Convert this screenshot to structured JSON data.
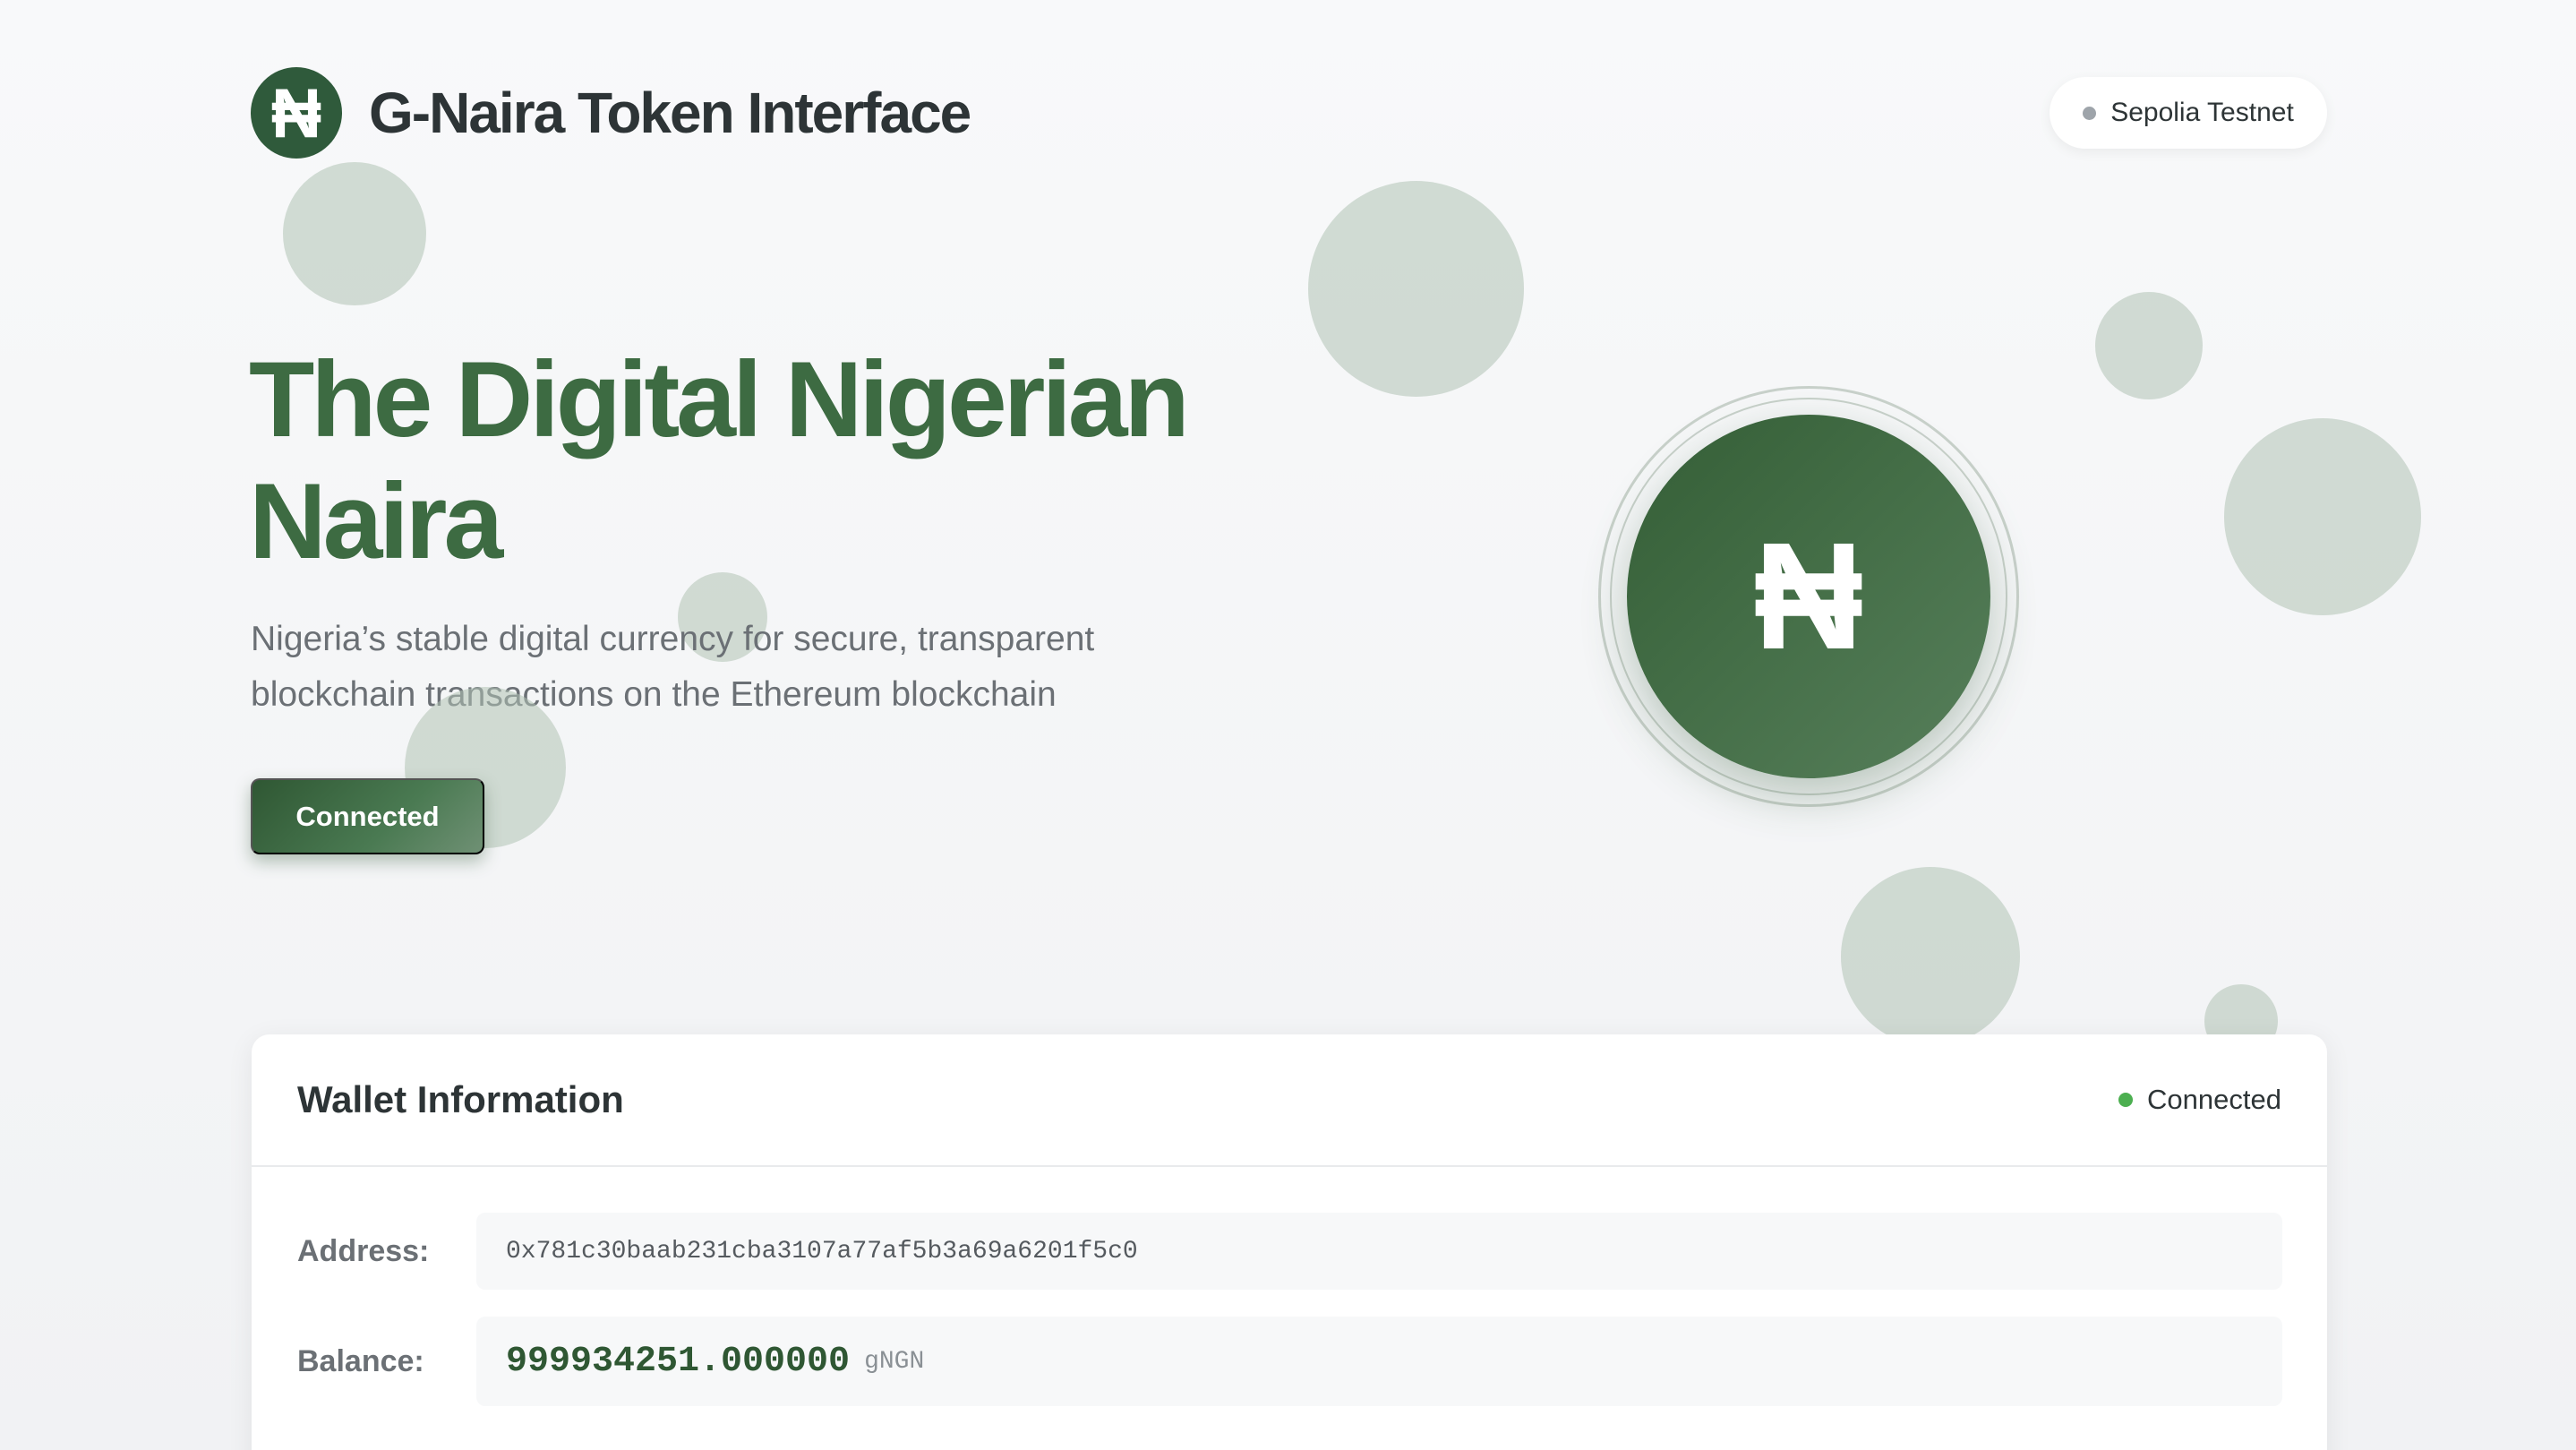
{
  "header": {
    "logo_symbol": "₦",
    "title": "G-Naira Token Interface"
  },
  "network": {
    "label": "Sepolia Testnet",
    "dot_color": "#9ea4aa"
  },
  "hero": {
    "title_line1": "The Digital Nigerian",
    "title_line2": "Naira",
    "subtitle_line1": "Nigeria’s stable digital currency for secure, transparent",
    "subtitle_line2": "blockchain transactions on the Ethereum blockchain",
    "button_label": "Connected",
    "coin_symbol": "₦"
  },
  "wallet": {
    "title": "Wallet Information",
    "status_label": "Connected",
    "status_color": "#4caf50",
    "address_label": "Address:",
    "address_value": "0x781c30baab231cba3107a77af5b3a69a6201f5c0",
    "balance_label": "Balance:",
    "balance_value": "999934251.000000",
    "balance_unit": "gNGN"
  },
  "colors": {
    "brand_green": "#2f5a3b",
    "hero_green": "#3d6b42",
    "text_dark": "#2d3436",
    "text_muted": "#6b7075"
  },
  "icons": {
    "logo": "naira-icon",
    "coin": "naira-coin-icon",
    "network_status": "status-dot-icon",
    "wallet_status": "status-dot-icon"
  }
}
